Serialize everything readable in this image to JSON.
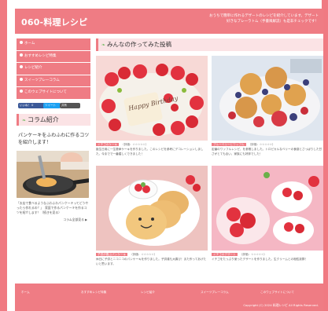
{
  "header": {
    "site_title": "060-料理レシピ",
    "site_description": "おうちで簡単に作れるデザートのレシピを紹介しています。デザート好きなブレ一ラトム（手書風解説）も是非チェックです！"
  },
  "sidebar": {
    "nav": [
      {
        "label": "ホーム"
      },
      {
        "label": "おすすめレシピ特集"
      },
      {
        "label": "レシピ紹介"
      },
      {
        "label": "スイーツブレ一コラム"
      },
      {
        "label": "このウェブサイトについて"
      }
    ],
    "social": {
      "facebook": "いいね！ 0",
      "twitter": "ツイート",
      "share": "共有"
    },
    "column_heading": "コラム紹介",
    "column_title": "パンケーキをふわふわに作るコツを紹介します！",
    "column_caption": "「お店で食べるようなふわふわパンケーキってどうやったら作れるの？」　家庭で作るパンケーキを作るコツを紹介します！（続きを見る）",
    "column_more": "コラム全部見る ▶"
  },
  "main": {
    "heading": "みんなの作ってみた投稿",
    "cards": [
      {
        "tag": "イチゴのケーキ",
        "meta": "（評価：☆☆☆☆☆）",
        "desc": "誕生日用に一生懸命ケーキを作りました。このレシピを参考にデコレーションしました。今までで一番嬉しくできました！",
        "cake_text": "Happy Birthday"
      },
      {
        "tag": "ブルーベリーとワッフル",
        "meta": "（評価：☆☆☆☆☆）",
        "desc": "定番のワッフルレシピ、を参照しました。トロピカルなベリーの食感とさっぱりした甘さがとても合い、家族にも好評でした！"
      },
      {
        "tag": "子供が喜ぶパンケーキ",
        "meta": "（評価：☆☆☆☆☆）",
        "desc": "休日に子供とニコニコのパンケーキを作りました。子供達も大喜び！また作ってあげたいと思います。"
      },
      {
        "tag": "イチゴのデザート",
        "meta": "（評価：☆☆☆☆☆）",
        "desc": "イチゴをたっぷり使ったデザートを作りました。生クリームとの相性抜群！"
      }
    ]
  },
  "footer": {
    "nav": [
      "ホーム",
      "おすすめレシピ特集",
      "レシピ紹介",
      "スイーツブレ一コラム",
      "このウェブサイトについて"
    ],
    "copyright": "Copyright (C) 2024 料理レシピ All Rights Reserved."
  },
  "colors": {
    "brand": "#ef7c84",
    "accent_light": "#fbe3e5",
    "leaf": "#7bbd6a"
  }
}
